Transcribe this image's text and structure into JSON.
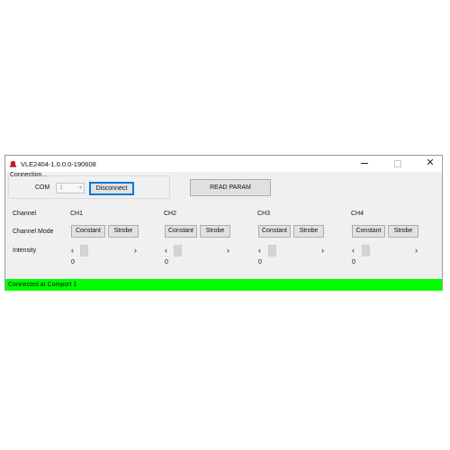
{
  "window": {
    "title": "VLE2404-1.0.0.0-190608",
    "close_glyph": "✕"
  },
  "connection": {
    "group_label": "Connection...",
    "com_label": "COM",
    "com_value": "1",
    "disconnect_label": "Disconnect"
  },
  "read_param_label": "READ PARAM",
  "labels": {
    "channel": "Channel",
    "channel_mode": "Channel Mode",
    "intensity": "Intensity"
  },
  "channels": [
    {
      "name": "CH1",
      "constant_label": "Constant",
      "strobe_label": "Strobe",
      "intensity": "0"
    },
    {
      "name": "CH2",
      "constant_label": "Constant",
      "strobe_label": "Strobe",
      "intensity": "0"
    },
    {
      "name": "CH3",
      "constant_label": "Constant",
      "strobe_label": "Strobe",
      "intensity": "0"
    },
    {
      "name": "CH4",
      "constant_label": "Constant",
      "strobe_label": "Strobe",
      "intensity": "0"
    }
  ],
  "slider_arrows": {
    "left": "‹",
    "right": "›"
  },
  "status": {
    "text": "Connected at Comport 1",
    "color": "#00ff00"
  },
  "icons": {
    "app": "red-alarm-light-icon",
    "minimize": "minimize-icon",
    "maximize": "maximize-icon",
    "close": "close-icon"
  }
}
